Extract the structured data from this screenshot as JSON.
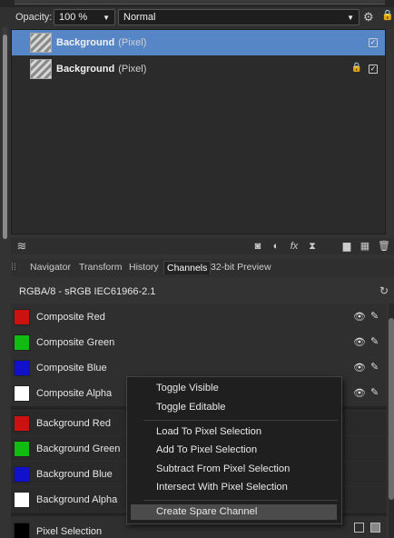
{
  "layers_panel": {
    "opacity_label": "Opacity:",
    "opacity_value": "100 %",
    "blend_mode": "Normal",
    "layers": [
      {
        "name": "Background",
        "kind": "(Pixel)"
      },
      {
        "name": "Background",
        "kind": "(Pixel)"
      }
    ]
  },
  "tabs": [
    "Navigator",
    "Transform",
    "History",
    "Channels",
    "32-bit Preview"
  ],
  "channels_panel": {
    "profile": "RGBA/8 - sRGB IEC61966-2.1",
    "composite_channels": [
      {
        "name": "Composite Red",
        "color": "#cc1111"
      },
      {
        "name": "Composite Green",
        "color": "#11bb11"
      },
      {
        "name": "Composite Blue",
        "color": "#1111cc"
      },
      {
        "name": "Composite Alpha",
        "color": "#ffffff"
      }
    ],
    "layer_channels": [
      {
        "name": "Background Red",
        "color": "#cc1111"
      },
      {
        "name": "Background Green",
        "color": "#11bb11"
      },
      {
        "name": "Background Blue",
        "color": "#1111cc"
      },
      {
        "name": "Background Alpha",
        "color": "#ffffff"
      }
    ],
    "last_row": "Pixel Selection"
  },
  "context_menu": {
    "items": [
      "Toggle Visible",
      "Toggle Editable",
      "Load To Pixel Selection",
      "Add To Pixel Selection",
      "Subtract From Pixel Selection",
      "Intersect With Pixel Selection",
      "Create Spare Channel"
    ]
  }
}
